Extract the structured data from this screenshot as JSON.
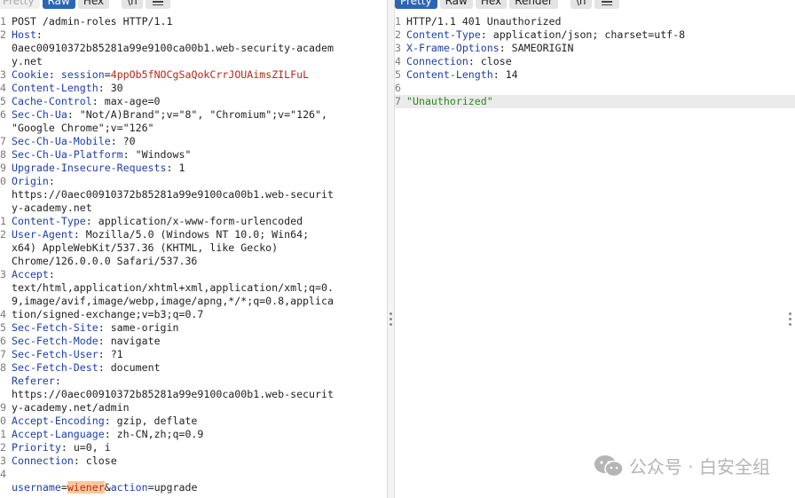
{
  "request_pane": {
    "toolbar": {
      "pretty": "Pretty",
      "raw": "Raw",
      "hex": "Hex",
      "ln_toggle": "\\n"
    },
    "line_numbers": [
      "1",
      "2",
      "",
      "3",
      "4",
      "5",
      "6",
      "",
      "7",
      "8",
      "9",
      "0",
      "",
      "1",
      "2",
      "",
      "",
      "3",
      "",
      "",
      "4",
      "5",
      "6",
      "7",
      "8",
      "",
      "9",
      "0",
      "1",
      "2",
      "3",
      "4"
    ],
    "lines": [
      {
        "request_line": "POST /admin-roles HTTP/1.1"
      },
      {
        "key": "Host",
        "value": ""
      },
      {
        "cont": "0aec00910372b85281a99e9100ca00b1.web-security-academ"
      },
      {
        "cont": "y.net"
      },
      {
        "cookie_key": "Cookie",
        "cookie_name": "session",
        "cookie_value": "4ppOb5fNOCgSaQokCrrJOUAimsZILFuL"
      },
      {
        "key": "Content-Length",
        "value": "30"
      },
      {
        "key": "Cache-Control",
        "value": "max-age=0"
      },
      {
        "key": "Sec-Ch-Ua",
        "value": "\"Not/A)Brand\";v=\"8\", \"Chromium\";v=\"126\","
      },
      {
        "cont": "\"Google Chrome\";v=\"126\""
      },
      {
        "key": "Sec-Ch-Ua-Mobile",
        "value": "?0"
      },
      {
        "key": "Sec-Ch-Ua-Platform",
        "value": "\"Windows\""
      },
      {
        "key": "Upgrade-Insecure-Requests",
        "value": "1"
      },
      {
        "key": "Origin",
        "value": ""
      },
      {
        "cont": "https://0aec00910372b85281a99e9100ca00b1.web-securit"
      },
      {
        "cont": "y-academy.net"
      },
      {
        "key": "Content-Type",
        "value": "application/x-www-form-urlencoded"
      },
      {
        "key": "User-Agent",
        "value": "Mozilla/5.0 (Windows NT 10.0; Win64;"
      },
      {
        "cont": "x64) AppleWebKit/537.36 (KHTML, like Gecko)"
      },
      {
        "cont": "Chrome/126.0.0.0 Safari/537.36"
      },
      {
        "key": "Accept",
        "value": ""
      },
      {
        "cont": "text/html,application/xhtml+xml,application/xml;q=0."
      },
      {
        "cont": "9,image/avif,image/webp,image/apng,*/*;q=0.8,applica"
      },
      {
        "cont": "tion/signed-exchange;v=b3;q=0.7"
      },
      {
        "key": "Sec-Fetch-Site",
        "value": "same-origin"
      },
      {
        "key": "Sec-Fetch-Mode",
        "value": "navigate"
      },
      {
        "key": "Sec-Fetch-User",
        "value": "?1"
      },
      {
        "key": "Sec-Fetch-Dest",
        "value": "document"
      },
      {
        "key": "Referer",
        "value": ""
      },
      {
        "cont": "https://0aec00910372b85281a99e9100ca00b1.web-securit"
      },
      {
        "cont": "y-academy.net/admin"
      },
      {
        "key": "Accept-Encoding",
        "value": "gzip, deflate"
      },
      {
        "key": "Accept-Language",
        "value": "zh-CN,zh;q=0.9"
      },
      {
        "key": "Priority",
        "value": "u=0, i"
      },
      {
        "key": "Connection",
        "value": "close"
      },
      {
        "blank": ""
      },
      {
        "body": [
          {
            "k": "username",
            "v": "wiener",
            "highlight": true
          },
          {
            "k": "action",
            "v": "upgrade",
            "highlight": false
          }
        ]
      }
    ],
    "line_numbers_full": [
      "1",
      "2",
      "",
      "",
      "3",
      "4",
      "5",
      "6",
      "",
      "7",
      "8",
      "9",
      "0",
      "",
      "",
      "1",
      "2",
      "",
      "",
      "3",
      "",
      "",
      "4",
      "5",
      "6",
      "7",
      "8",
      "",
      "",
      "9",
      "0",
      "1",
      "2",
      "3",
      "4"
    ]
  },
  "response_pane": {
    "toolbar": {
      "pretty": "Pretty",
      "raw": "Raw",
      "hex": "Hex",
      "render": "Render",
      "ln_toggle": "\\n"
    },
    "lines": [
      {
        "n": "1",
        "status_line": "HTTP/1.1 401 Unauthorized"
      },
      {
        "n": "2",
        "key": "Content-Type",
        "value": "application/json; charset=utf-8"
      },
      {
        "n": "3",
        "key": "X-Frame-Options",
        "value": "SAMEORIGIN"
      },
      {
        "n": "4",
        "key": "Connection",
        "value": "close"
      },
      {
        "n": "5",
        "key": "Content-Length",
        "value": "14"
      },
      {
        "n": "6",
        "blank": ""
      },
      {
        "n": "7",
        "json_string": "\"Unauthorized\""
      }
    ]
  },
  "watermark": {
    "text": "公众号 · 白安全组",
    "icon": "wechat-icon"
  },
  "colors": {
    "header_key": "#1d3fad",
    "cookie_value": "#b6281c",
    "json_string": "#2b8a1c",
    "active_tab": "#2c65b6",
    "highlight_bg": "#ffc89a"
  }
}
